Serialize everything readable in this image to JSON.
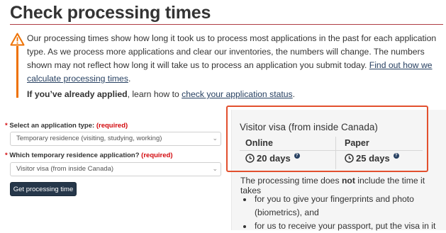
{
  "page": {
    "title": "Check processing times"
  },
  "warning": {
    "text_1": "Our processing times show how long it took us to process most applications in the past for each application type. As we process more applications and clear our inventories, the numbers will change. The numbers shown may not reflect how long it will take us to process an application you submit today. ",
    "link_1": "Find out how we calculate processing times",
    "text_1_end": ".",
    "already_applied_bold": "If you’ve already applied",
    "already_applied_text": ", learn how to ",
    "link_2": "check your application status",
    "text_2_end": "."
  },
  "form": {
    "field1": {
      "star": "*",
      "label": "Select an application type:",
      "required": "(required)",
      "value": "Temporary residence (visiting, studying, working)"
    },
    "field2": {
      "star": "*",
      "label": "Which temporary residence application?",
      "required": "(required)",
      "value": "Visitor visa (from inside Canada)"
    },
    "submit_label": "Get processing time"
  },
  "result": {
    "title": "Visitor visa (from inside Canada)",
    "columns": [
      {
        "label": "Online",
        "value": "20 days"
      },
      {
        "label": "Paper",
        "value": "25 days"
      }
    ],
    "info_glyph": "?",
    "note_prefix": "The processing time does ",
    "note_bold": "not",
    "note_suffix": " include the time it takes",
    "bullets": [
      "for you to give your fingerprints and photo (biometrics), and",
      "for us to receive your passport, put the visa in it"
    ]
  },
  "colors": {
    "accent_red": "#af3c43",
    "warning_orange": "#ee7100",
    "link_blue": "#284162",
    "button_navy": "#26374a",
    "highlight_red": "#e2502e",
    "required_red": "#d3080c"
  },
  "icons": {
    "warning": "warning-triangle-icon",
    "clock": "clock-icon",
    "info": "question-circle-icon",
    "chevron": "chevron-down-icon"
  }
}
